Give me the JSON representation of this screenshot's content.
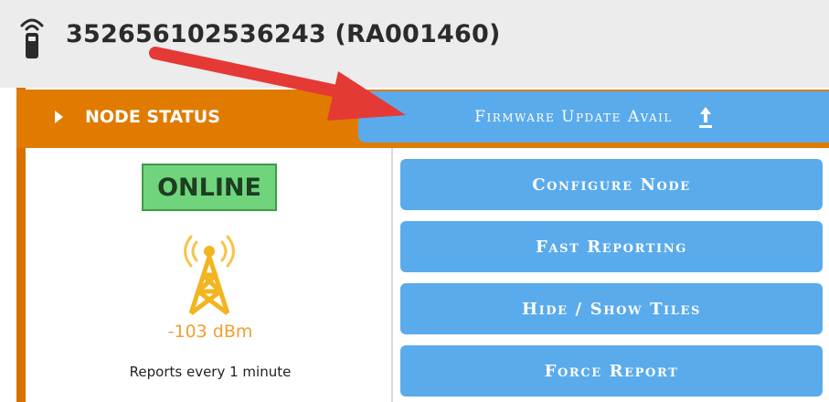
{
  "header": {
    "device_title": "352656102536243 (RA001460)",
    "device_icon": "remote-device-icon"
  },
  "node_status": {
    "label": "NODE STATUS",
    "toggle_icon": "caret-right-icon",
    "bar_color": "#e07b00"
  },
  "firmware": {
    "label": "Firmware Update Avail",
    "icon": "upload-icon",
    "color": "#5aabec"
  },
  "status": {
    "online_label": "ONLINE",
    "online_color": "#6fd47b",
    "signal_icon": "signal-tower-icon",
    "signal_strength": "-103 dBm",
    "signal_color": "#f0a030",
    "report_interval": "Reports every 1 minute"
  },
  "actions": {
    "configure_node": "Configure Node",
    "fast_reporting": "Fast Reporting",
    "hide_show_tiles": "Hide / Show Tiles",
    "force_report": "Force Report"
  },
  "annotation": {
    "arrow_icon": "red-arrow-icon",
    "arrow_color": "#e53935"
  }
}
